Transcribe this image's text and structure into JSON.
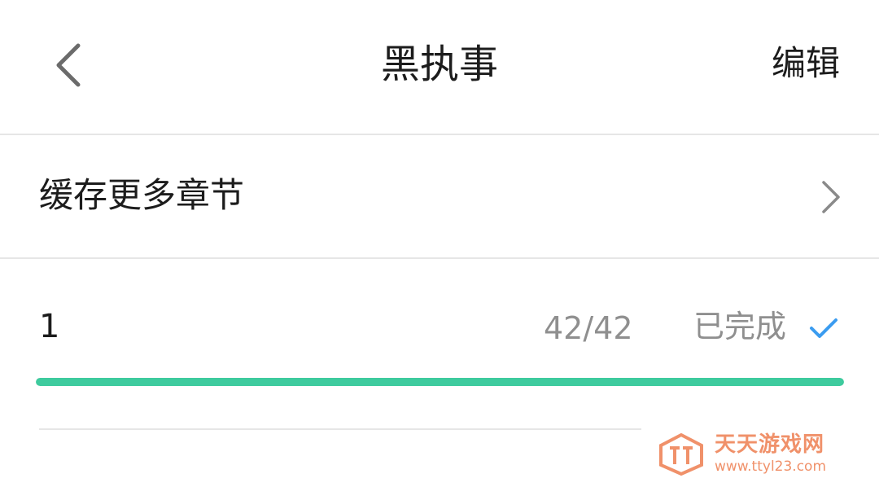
{
  "header": {
    "title": "黑执事",
    "edit_label": "编辑"
  },
  "cache_more": {
    "label": "缓存更多章节"
  },
  "download_items": [
    {
      "name": "1",
      "count": "42/42",
      "status": "已完成",
      "progress": 1.0
    }
  ],
  "watermark": {
    "name": "天天游戏网",
    "url": "www.ttyl23.com"
  },
  "colors": {
    "progress": "#3ecb9e",
    "check": "#3b9cf0",
    "text_primary": "#1c1c1c",
    "text_secondary": "#8f8f8f",
    "divider": "#e6e6e6",
    "watermark": "#f0916a"
  },
  "icons": {
    "back": "chevron-left-icon",
    "forward": "chevron-right-icon",
    "done": "check-icon"
  }
}
